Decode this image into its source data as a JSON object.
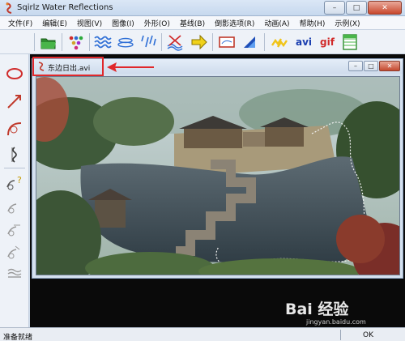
{
  "window": {
    "title": "Sqirlz Water Reflections",
    "minimize_glyph": "–",
    "maximize_glyph": "□",
    "close_glyph": "✕"
  },
  "menubar": {
    "items": [
      {
        "label": "文件(F)"
      },
      {
        "label": "编辑(E)"
      },
      {
        "label": "视图(V)"
      },
      {
        "label": "图像(I)"
      },
      {
        "label": "外形(O)"
      },
      {
        "label": "基线(B)"
      },
      {
        "label": "倒影选项(R)"
      },
      {
        "label": "动画(A)"
      },
      {
        "label": "帮助(H)"
      },
      {
        "label": "示例(X)"
      }
    ]
  },
  "toolbar": {
    "avi_label": "avi",
    "gif_label": "gif",
    "icons": [
      "open-folder-icon",
      "dots-icon",
      "wave-icon",
      "ripple-icon",
      "rain-icon",
      "bend-icon",
      "arrow-right-icon",
      "outline-icon",
      "triangle-icon",
      "lightning-icon",
      "avi-icon",
      "gif-icon",
      "grid-icon"
    ]
  },
  "lefttools": {
    "icons": [
      "ellipse-icon",
      "line-arrow-icon",
      "curve-icon",
      "ripple-stroke-icon",
      "help-shape-icon",
      "shape-a-icon",
      "shape-b-icon",
      "shape-c-icon",
      "shape-d-icon"
    ]
  },
  "document": {
    "name": "东边日出.avi",
    "minimize_glyph": "–",
    "maximize_glyph": "□",
    "close_glyph": "✕"
  },
  "watermark": {
    "main": "Bai 经验",
    "sub": "jingyan.baidu.com"
  },
  "statusbar": {
    "text": "准备就绪",
    "right": "OK"
  },
  "colors": {
    "highlight": "#e0282b",
    "workspace": "#0a0a0a"
  }
}
